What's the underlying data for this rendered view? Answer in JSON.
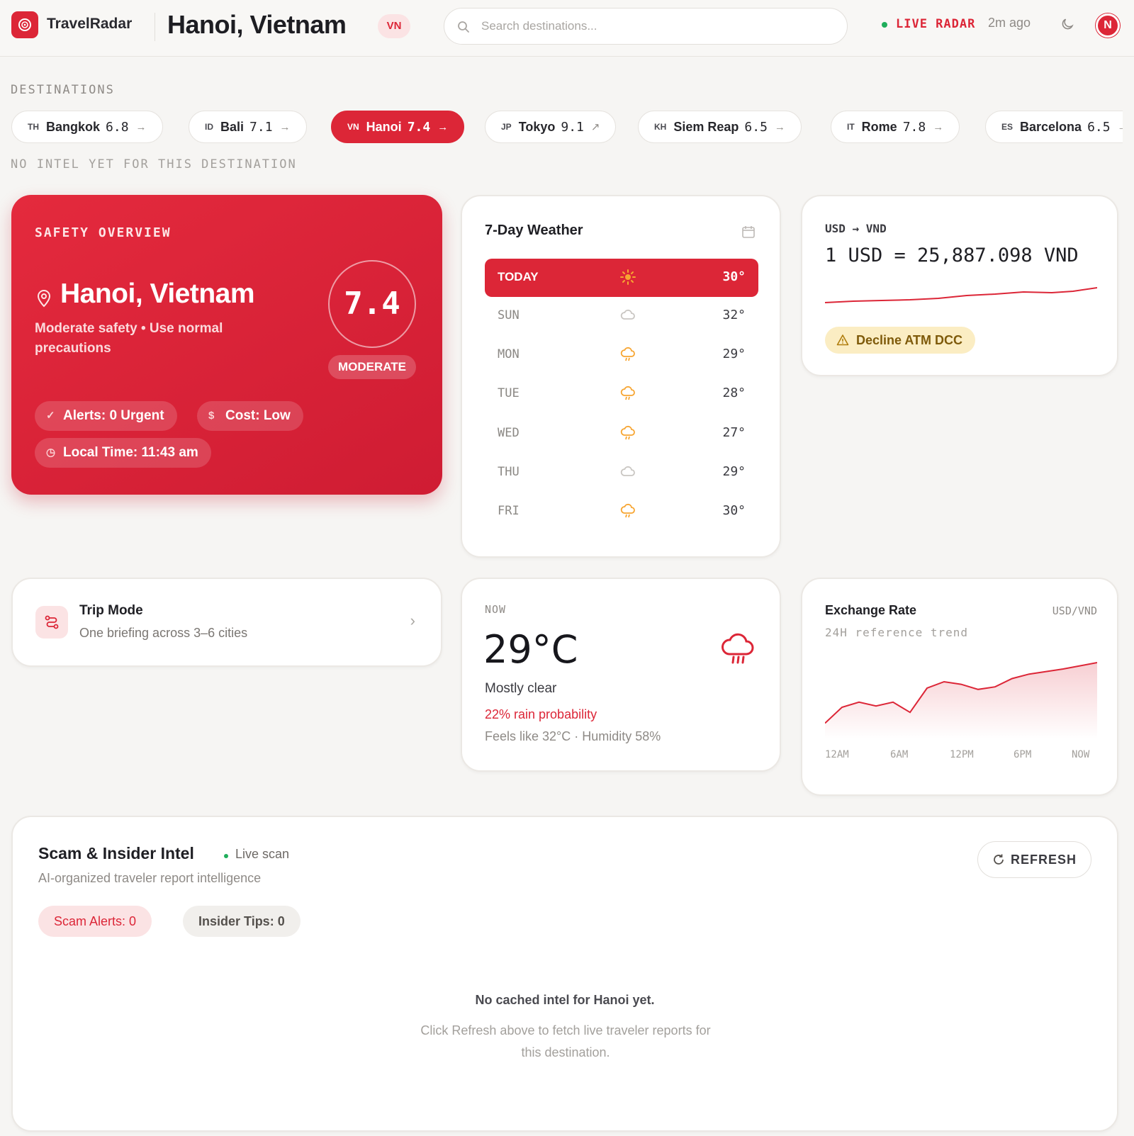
{
  "header": {
    "brand": "TravelRadar",
    "city_title": "Hanoi, Vietnam",
    "country_code": "VN",
    "search_placeholder": "Search destinations...",
    "live_label": "LIVE RADAR",
    "updated": "2m ago",
    "avatar_initial": "N"
  },
  "destinations": {
    "label": "DESTINATIONS",
    "no_intel_note": "NO INTEL YET FOR THIS DESTINATION",
    "items": [
      {
        "code": "TH",
        "name": "Bangkok",
        "score": "6.8",
        "arrow": "→",
        "active": false
      },
      {
        "code": "ID",
        "name": "Bali",
        "score": "7.1",
        "arrow": "→",
        "active": false
      },
      {
        "code": "VN",
        "name": "Hanoi",
        "score": "7.4",
        "arrow": "→",
        "active": true
      },
      {
        "code": "JP",
        "name": "Tokyo",
        "score": "9.1",
        "arrow": "↗",
        "active": false
      },
      {
        "code": "KH",
        "name": "Siem Reap",
        "score": "6.5",
        "arrow": "→",
        "active": false
      },
      {
        "code": "IT",
        "name": "Rome",
        "score": "7.8",
        "arrow": "→",
        "active": false
      },
      {
        "code": "ES",
        "name": "Barcelona",
        "score": "6.5",
        "arrow": "→",
        "active": false
      }
    ]
  },
  "safety": {
    "label": "SAFETY OVERVIEW",
    "city": "Hanoi, Vietnam",
    "description": "Moderate safety • Use normal precautions",
    "score": "7.4",
    "level": "MODERATE",
    "alerts": "Alerts: 0 Urgent",
    "cost": "Cost: Low",
    "local_time": "Local Time: 11:43 am"
  },
  "weather_week": {
    "title": "7-Day Weather",
    "today": {
      "day": "TODAY",
      "temp": "30°",
      "icon": "sun-icon"
    },
    "days": [
      {
        "day": "SUN",
        "temp": "32°",
        "icon": "cloud-icon"
      },
      {
        "day": "MON",
        "temp": "29°",
        "icon": "rain-cloud-icon"
      },
      {
        "day": "TUE",
        "temp": "28°",
        "icon": "rain-cloud-icon"
      },
      {
        "day": "WED",
        "temp": "27°",
        "icon": "rain-cloud-icon"
      },
      {
        "day": "THU",
        "temp": "29°",
        "icon": "cloud-icon"
      },
      {
        "day": "FRI",
        "temp": "30°",
        "icon": "rain-cloud-icon"
      }
    ]
  },
  "fx": {
    "pair": "USD → VND",
    "rate": "1 USD = 25,887.098 VND",
    "warning": "Decline ATM DCC"
  },
  "trip_mode": {
    "title": "Trip Mode",
    "subtitle": "One briefing across 3–6 cities"
  },
  "now_weather": {
    "label": "NOW",
    "temp": "29°C",
    "condition": "Mostly clear",
    "rain": "22% rain probability",
    "feels": "Feels like 32°C · Humidity 58%"
  },
  "exchange_chart": {
    "title": "Exchange Rate",
    "pair": "USD/VND",
    "subtitle": "24H reference trend",
    "accent": "#dc2637"
  },
  "chart_data": {
    "type": "area",
    "x": [
      "12AM",
      "6AM",
      "12PM",
      "6PM",
      "NOW"
    ],
    "series": [
      {
        "values": [
          0.05,
          0.3,
          0.38,
          0.32,
          0.38,
          0.22,
          0.6,
          0.7,
          0.66,
          0.58,
          0.62,
          0.75,
          0.82,
          0.86,
          0.9,
          0.95,
          1.0
        ]
      }
    ],
    "note": "relative trend, no y-axis labels shown"
  },
  "scam": {
    "title": "Scam & Insider Intel",
    "live": "Live scan",
    "subtitle": "AI-organized traveler report intelligence",
    "refresh": "REFRESH",
    "scam_alerts": "Scam Alerts: 0",
    "insider_tips": "Insider Tips: 0",
    "empty_title": "No cached intel for Hanoi yet.",
    "empty_body": "Click Refresh above to fetch live traveler reports for this destination."
  },
  "colors": {
    "accent": "#dc2637",
    "live": "#1fae5b",
    "warning_bg": "#fbedc3"
  }
}
